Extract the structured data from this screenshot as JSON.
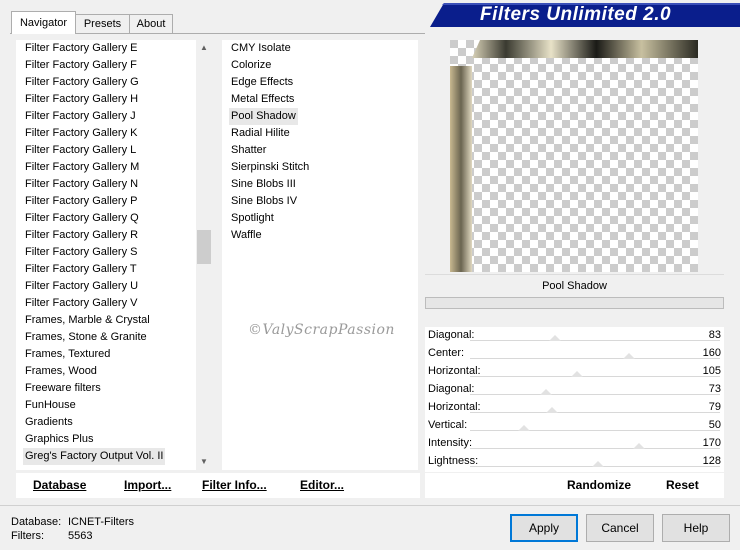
{
  "banner": {
    "title": "Filters Unlimited 2.0"
  },
  "tabs": [
    "Navigator",
    "Presets",
    "About"
  ],
  "categories": [
    "Filter Factory Gallery E",
    "Filter Factory Gallery F",
    "Filter Factory Gallery G",
    "Filter Factory Gallery H",
    "Filter Factory Gallery J",
    "Filter Factory Gallery K",
    "Filter Factory Gallery L",
    "Filter Factory Gallery M",
    "Filter Factory Gallery N",
    "Filter Factory Gallery P",
    "Filter Factory Gallery Q",
    "Filter Factory Gallery R",
    "Filter Factory Gallery S",
    "Filter Factory Gallery T",
    "Filter Factory Gallery U",
    "Filter Factory Gallery V",
    "Frames, Marble & Crystal",
    "Frames, Stone & Granite",
    "Frames, Textured",
    "Frames, Wood",
    "Freeware filters",
    "FunHouse",
    "Gradients",
    "Graphics Plus",
    "Greg's Factory Output Vol. II"
  ],
  "selected_category": "Greg's Factory Output Vol. II",
  "filters": [
    "CMY Isolate",
    "Colorize",
    "Edge Effects",
    "Metal Effects",
    "Pool Shadow",
    "Radial Hilite",
    "Shatter",
    "Sierpinski Stitch",
    "Sine Blobs III",
    "Sine Blobs IV",
    "Spotlight",
    "Waffle"
  ],
  "selected_filter": "Pool Shadow",
  "preview": {
    "filter_name": "Pool Shadow"
  },
  "watermark": "©ValyScrapPassion",
  "params": [
    {
      "label": "Diagonal:",
      "value": "83",
      "fraction": 0.325
    },
    {
      "label": "Center:",
      "value": "160",
      "fraction": 0.627
    },
    {
      "label": "Horizontal:",
      "value": "105",
      "fraction": 0.412
    },
    {
      "label": "Diagonal:",
      "value": "73",
      "fraction": 0.286
    },
    {
      "label": "Horizontal:",
      "value": "79",
      "fraction": 0.31
    },
    {
      "label": "Vertical:",
      "value": "50",
      "fraction": 0.196
    },
    {
      "label": "Intensity:",
      "value": "170",
      "fraction": 0.667
    },
    {
      "label": "Lightness:",
      "value": "128",
      "fraction": 0.502
    }
  ],
  "left_buttons": [
    "Database",
    "Import...",
    "Filter Info...",
    "Editor..."
  ],
  "right_buttons": [
    "Randomize",
    "Reset"
  ],
  "status": {
    "database_label": "Database:",
    "database_value": "ICNET-Filters",
    "filters_label": "Filters:",
    "filters_value": "5563"
  },
  "dialog_buttons": {
    "apply": "Apply",
    "cancel": "Cancel",
    "help": "Help"
  },
  "colors": {
    "banner": "#0a1e8c",
    "accent": "#0078d7"
  }
}
